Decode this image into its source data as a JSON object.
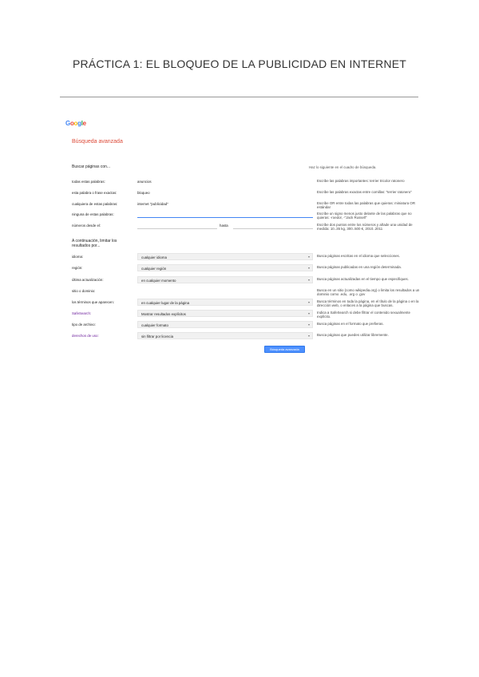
{
  "doc_title": "PRÁCTICA 1: EL BLOQUEO DE LA PUBLICIDAD EN INTERNET",
  "google": {
    "logo": "Google",
    "page_title": "Búsqueda avanzada",
    "section1": {
      "heading": "Buscar páginas con...",
      "hint_heading": "Haz lo siguiente en el cuadro de búsqueda.",
      "rows": [
        {
          "label": "todas estas palabras:",
          "value": "anuncios",
          "hint": "Escribe las palabras importantes: terrier tricolor ratonero"
        },
        {
          "label": "esta palabra o frase exactas:",
          "value": "bloqueo",
          "hint": "Escribe las palabras exactas entre comillas: \"terrier ratonero\""
        },
        {
          "label": "cualquiera de estas palabras:",
          "value": "internet \"publicidad\"",
          "hint": "Escribe OR entre todas las palabras que quieras: miniatura OR estándar"
        },
        {
          "label": "ninguna de estas palabras:",
          "value": "",
          "hint": "Escribe un signo menos justo delante de las palabras que no quieras: -roedor, -\"Jack Russell\""
        },
        {
          "label": "números desde el:",
          "value": "",
          "to_label": "hasta",
          "hint": "Escribe dos puntos entre los números y añade una unidad de medida: 10..35 kg, 300..500 €, 2010..2011"
        }
      ]
    },
    "section2": {
      "heading": "A continuación, limitar los resultados por...",
      "rows": [
        {
          "label": "idioma:",
          "value": "cualquier idioma",
          "hint": "Busca páginas escritas en el idioma que selecciones."
        },
        {
          "label": "región:",
          "value": "cualquier región",
          "hint": "Busca páginas publicadas en una región determinada."
        },
        {
          "label": "última actualización:",
          "value": "en cualquier momento",
          "hint": "Busca páginas actualizadas en el tiempo que especifiques."
        },
        {
          "label": "sitio o dominio:",
          "value": "",
          "hint": "Busca en un sitio (como wikipedia.org) o limita los resultados a un dominio como .edu, .org o .gov"
        },
        {
          "label": "los términos que aparecen:",
          "value": "en cualquier lugar de la página",
          "hint": "Busca términos en toda la página, en el título de la página o en la dirección web, o enlaces a la página que buscas."
        },
        {
          "label": "SafeSearch:",
          "value": "Mostrar resultados explícitos",
          "hint": "Indica a SafeSearch si debe filtrar el contenido sexualmente explícito."
        },
        {
          "label": "tipo de archivo:",
          "value": "cualquier formato",
          "hint": "Busca páginas en el formato que prefieras."
        },
        {
          "label": "derechos de uso:",
          "value": "sin filtrar por licencia",
          "hint": "Busca páginas que puedes utilizar libremente."
        }
      ]
    },
    "button": "Búsqueda avanzada"
  }
}
